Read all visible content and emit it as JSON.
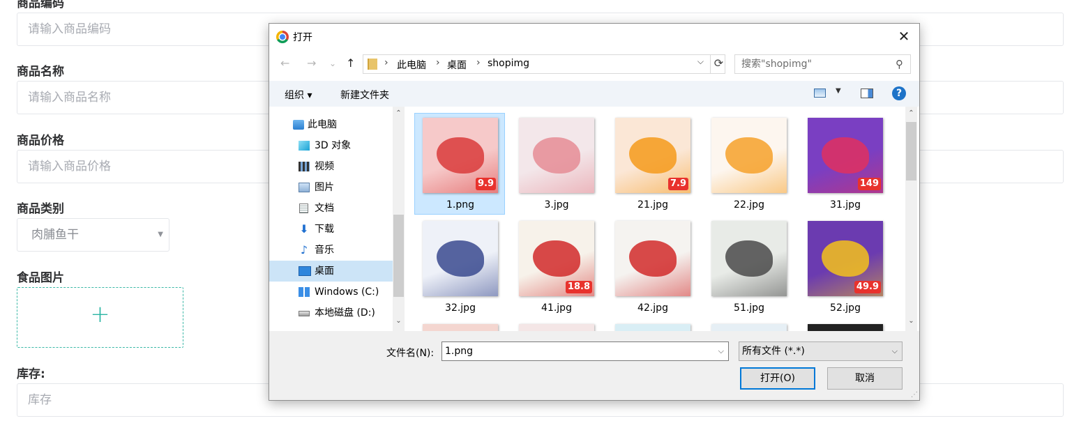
{
  "form": {
    "code_label": "商品编码",
    "code_placeholder": "请输入商品编码",
    "name_label": "商品名称",
    "name_placeholder": "请输入商品名称",
    "price_label": "商品价格",
    "price_placeholder": "请输入商品价格",
    "category_label": "商品类别",
    "category_value": "肉脯鱼干",
    "image_label": "食品图片",
    "upload_plus": "+",
    "stock_label": "库存:",
    "stock_placeholder": "库存"
  },
  "dialog": {
    "title": "打开",
    "close": "✕",
    "nav": {
      "back": "←",
      "forward": "→",
      "recent": "⌄",
      "up": "↑"
    },
    "breadcrumb": [
      "此电脑",
      "桌面",
      "shopimg"
    ],
    "search_placeholder": "搜索\"shopimg\"",
    "toolbar": {
      "organize": "组织 ▾",
      "new_folder": "新建文件夹",
      "help": "?"
    },
    "nav_items": [
      {
        "label": "此电脑",
        "icon": "pc-icon"
      },
      {
        "label": "3D 对象",
        "icon": "cube-icon"
      },
      {
        "label": "视频",
        "icon": "video-icon"
      },
      {
        "label": "图片",
        "icon": "pictures-icon"
      },
      {
        "label": "文档",
        "icon": "document-icon"
      },
      {
        "label": "下载",
        "icon": "download-icon"
      },
      {
        "label": "音乐",
        "icon": "music-icon"
      },
      {
        "label": "桌面",
        "icon": "desktop-icon",
        "selected": true
      },
      {
        "label": "Windows (C:)",
        "icon": "drive-c-icon"
      },
      {
        "label": "本地磁盘 (D:)",
        "icon": "drive-d-icon"
      }
    ],
    "files": [
      {
        "name": "1.png",
        "selected": true,
        "bg": "#f6c9c9",
        "accent": "#d93b3b",
        "tag": "9.9"
      },
      {
        "name": "3.jpg",
        "bg": "#f3e7ea",
        "accent": "#e58c95",
        "tag": ""
      },
      {
        "name": "21.jpg",
        "bg": "#fbe7d6",
        "accent": "#f59a1b",
        "tag": "7.9"
      },
      {
        "name": "22.jpg",
        "bg": "#fdf6ef",
        "accent": "#f6a12a",
        "tag": ""
      },
      {
        "name": "31.jpg",
        "bg": "#7a3fc2",
        "accent": "#e0305f",
        "tag": "149"
      },
      {
        "name": "32.jpg",
        "bg": "#eef1f8",
        "accent": "#3a4a8f",
        "tag": ""
      },
      {
        "name": "41.jpg",
        "bg": "#f7f2ea",
        "accent": "#d12a2a",
        "tag": "18.8"
      },
      {
        "name": "42.jpg",
        "bg": "#f5f3f0",
        "accent": "#d12a2a",
        "tag": ""
      },
      {
        "name": "51.jpg",
        "bg": "#e8ebe7",
        "accent": "#4a4a4a",
        "tag": ""
      },
      {
        "name": "52.jpg",
        "bg": "#6b3bb0",
        "accent": "#f4c21b",
        "tag": "49.9"
      },
      {
        "name": "",
        "bg": "#f4d6d0",
        "accent": "#d94a4a",
        "tag": ""
      },
      {
        "name": "",
        "bg": "#f4e6e6",
        "accent": "#d94a4a",
        "tag": ""
      },
      {
        "name": "",
        "bg": "#d9eef5",
        "accent": "#3aa2c9",
        "tag": ""
      },
      {
        "name": "",
        "bg": "#e6eff5",
        "accent": "#5a8bb3",
        "tag": ""
      },
      {
        "name": "",
        "bg": "#222222",
        "accent": "#c62828",
        "tag": ""
      }
    ],
    "filename_label": "文件名(N):",
    "filename_value": "1.png",
    "filetype_value": "所有文件 (*.*)",
    "open_button": "打开(O)",
    "cancel_button": "取消"
  }
}
